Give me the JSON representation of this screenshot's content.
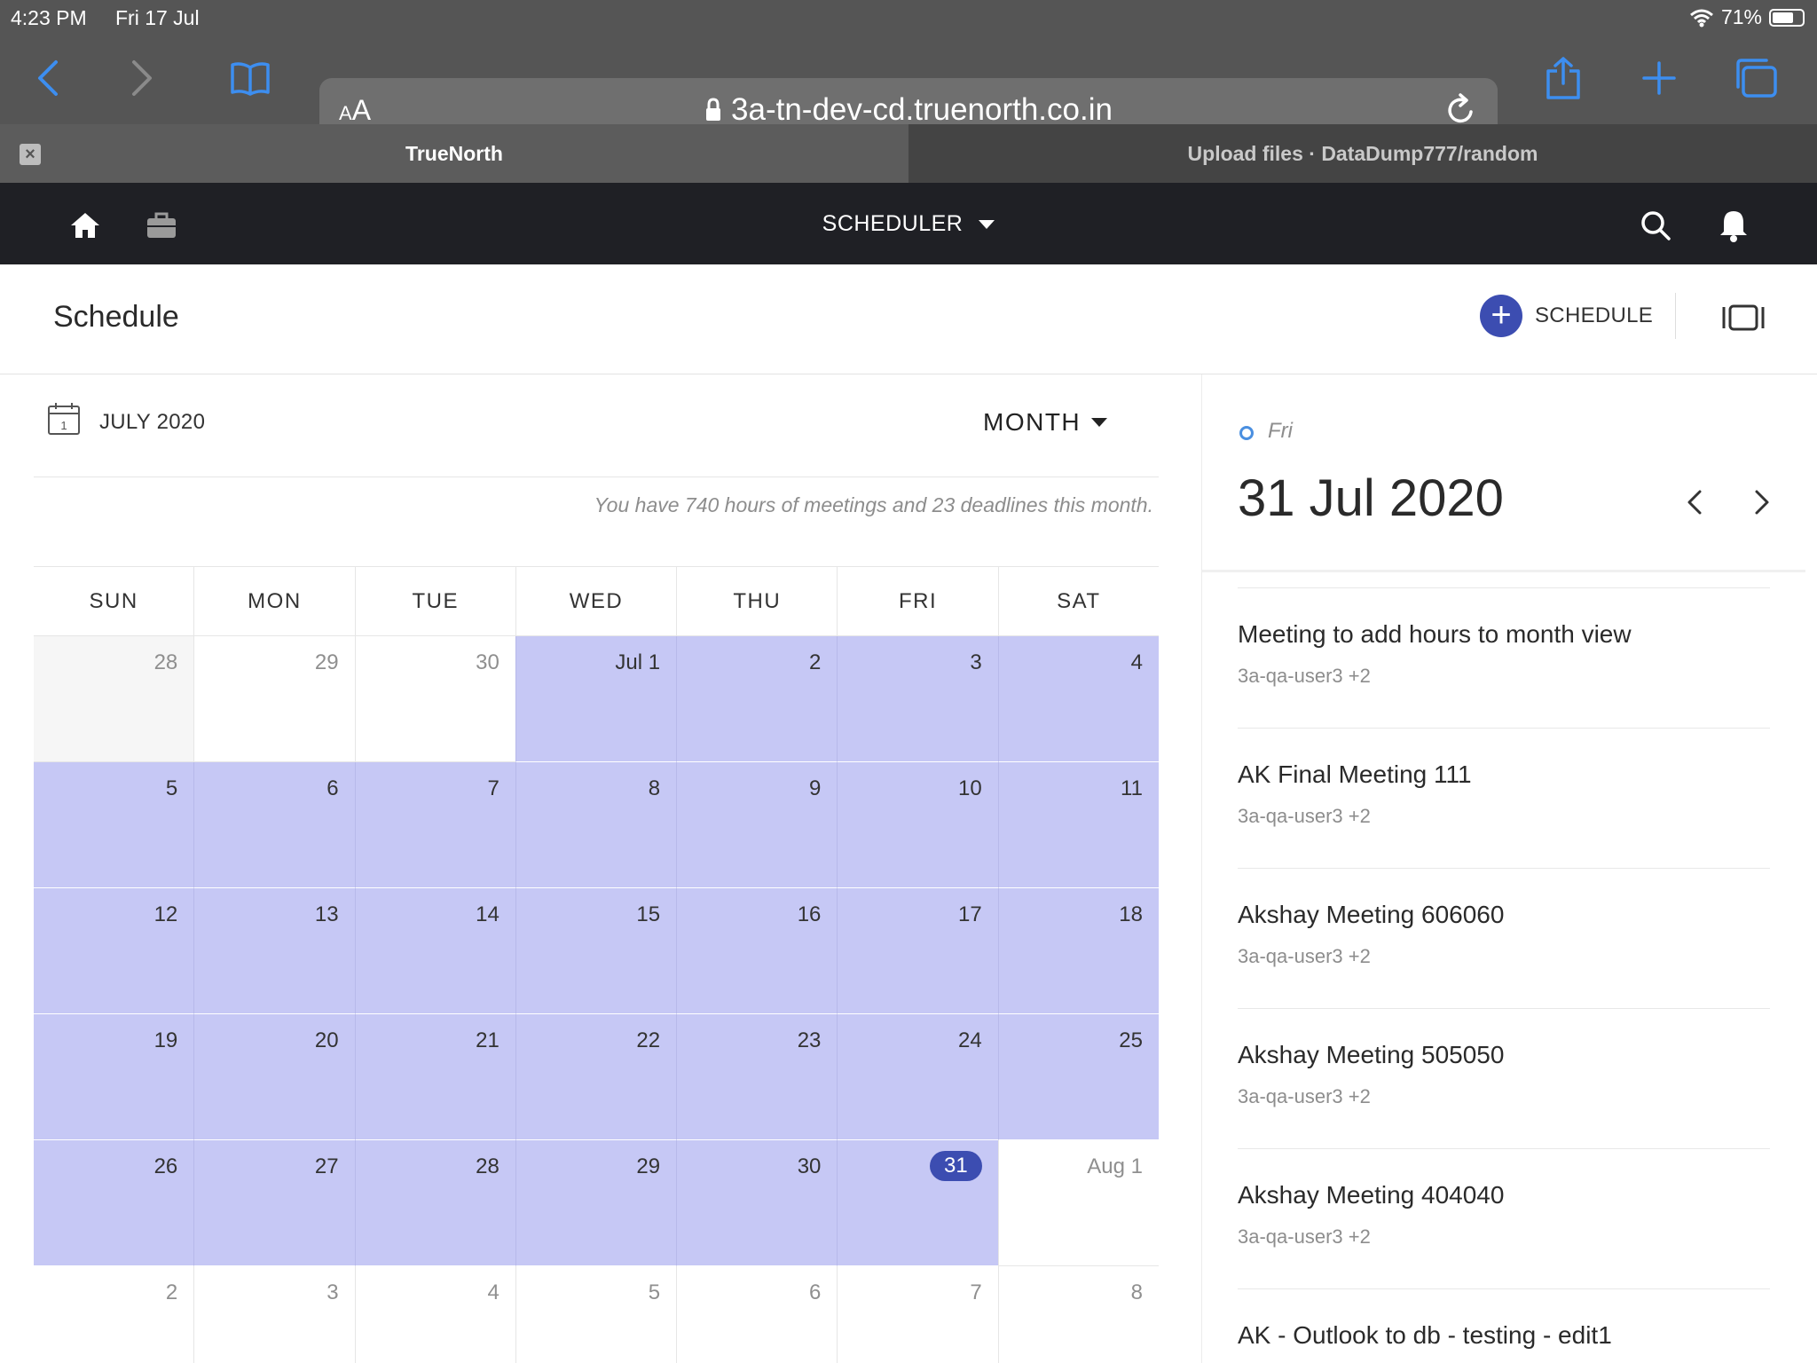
{
  "status": {
    "time": "4:23 PM",
    "date": "Fri 17 Jul",
    "battery": "71%",
    "battery_level": 0.71
  },
  "browser": {
    "url": "3a-tn-dev-cd.truenorth.co.in",
    "reader_label": "AA",
    "tabs": [
      {
        "title": "TrueNorth",
        "active": true
      },
      {
        "title": "Upload files · DataDump777/random",
        "active": false
      }
    ]
  },
  "appnav": {
    "title": "SCHEDULER"
  },
  "header": {
    "title": "Schedule",
    "schedule_button": "SCHEDULE"
  },
  "calendar": {
    "month_label": "JULY 2020",
    "view": "MONTH",
    "summary": "You have 740 hours of meetings and 23 deadlines this month.",
    "weekdays": [
      "SUN",
      "MON",
      "TUE",
      "WED",
      "THU",
      "FRI",
      "SAT"
    ],
    "weeks": [
      [
        {
          "label": "28",
          "state": "prev"
        },
        {
          "label": "29",
          "state": "prev-white"
        },
        {
          "label": "30",
          "state": "prev-white"
        },
        {
          "label": "Jul 1",
          "state": "range"
        },
        {
          "label": "2",
          "state": "range"
        },
        {
          "label": "3",
          "state": "range"
        },
        {
          "label": "4",
          "state": "range"
        }
      ],
      [
        {
          "label": "5",
          "state": "range"
        },
        {
          "label": "6",
          "state": "range"
        },
        {
          "label": "7",
          "state": "range"
        },
        {
          "label": "8",
          "state": "range"
        },
        {
          "label": "9",
          "state": "range"
        },
        {
          "label": "10",
          "state": "range"
        },
        {
          "label": "11",
          "state": "range"
        }
      ],
      [
        {
          "label": "12",
          "state": "range"
        },
        {
          "label": "13",
          "state": "range"
        },
        {
          "label": "14",
          "state": "range"
        },
        {
          "label": "15",
          "state": "range"
        },
        {
          "label": "16",
          "state": "range"
        },
        {
          "label": "17",
          "state": "range"
        },
        {
          "label": "18",
          "state": "range"
        }
      ],
      [
        {
          "label": "19",
          "state": "range"
        },
        {
          "label": "20",
          "state": "range"
        },
        {
          "label": "21",
          "state": "range"
        },
        {
          "label": "22",
          "state": "range"
        },
        {
          "label": "23",
          "state": "range"
        },
        {
          "label": "24",
          "state": "range"
        },
        {
          "label": "25",
          "state": "range"
        }
      ],
      [
        {
          "label": "26",
          "state": "range"
        },
        {
          "label": "27",
          "state": "range"
        },
        {
          "label": "28",
          "state": "range"
        },
        {
          "label": "29",
          "state": "range"
        },
        {
          "label": "30",
          "state": "range"
        },
        {
          "label": "31",
          "state": "today"
        },
        {
          "label": "Aug 1",
          "state": "next"
        }
      ],
      [
        {
          "label": "2",
          "state": "next"
        },
        {
          "label": "3",
          "state": "next"
        },
        {
          "label": "4",
          "state": "next"
        },
        {
          "label": "5",
          "state": "next"
        },
        {
          "label": "6",
          "state": "next"
        },
        {
          "label": "7",
          "state": "next"
        },
        {
          "label": "8",
          "state": "next"
        }
      ]
    ]
  },
  "selected_day": {
    "day_name": "Fri",
    "date": "31 Jul 2020",
    "events": [
      {
        "title": "Meeting to add hours to month view",
        "attendees": "3a-qa-user3 +2"
      },
      {
        "title": "AK Final Meeting 111",
        "attendees": "3a-qa-user3 +2"
      },
      {
        "title": "Akshay Meeting 606060",
        "attendees": "3a-qa-user3 +2"
      },
      {
        "title": "Akshay Meeting 505050",
        "attendees": "3a-qa-user3 +2"
      },
      {
        "title": "Akshay Meeting 404040",
        "attendees": "3a-qa-user3 +2"
      },
      {
        "title": "AK - Outlook to db - testing - edit1",
        "attendees": ""
      }
    ]
  },
  "colors": {
    "accent": "#3c4db1",
    "range_fill": "#c6c8f5",
    "safari_blue": "#3d8ef0",
    "nav_bg": "#1f2025"
  }
}
